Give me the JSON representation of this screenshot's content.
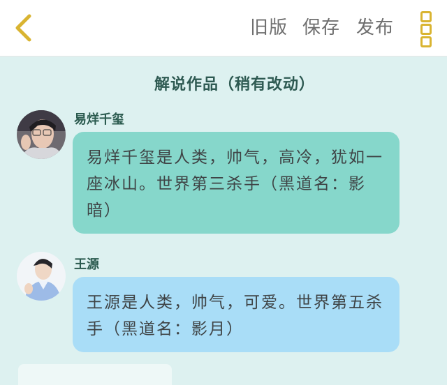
{
  "toolbar": {
    "back_icon": "chevron-left-icon",
    "old_version_label": "旧版",
    "save_label": "保存",
    "publish_label": "发布",
    "more_icon": "more-vertical-icon",
    "accent_color": "#d9b431"
  },
  "chat": {
    "title": "解说作品（稍有改动）",
    "messages": [
      {
        "speaker": "易烊千玺",
        "text": "易烊千玺是人类，帅气，高冷，犹如一座冰山。世界第三杀手（黑道名：影暗）",
        "bubble_color": "#86d7cb"
      },
      {
        "speaker": "王源",
        "text": "王源是人类，帅气，可爱。世界第五杀手（黑道名：影月）",
        "bubble_color": "#a9ddf7"
      }
    ]
  }
}
